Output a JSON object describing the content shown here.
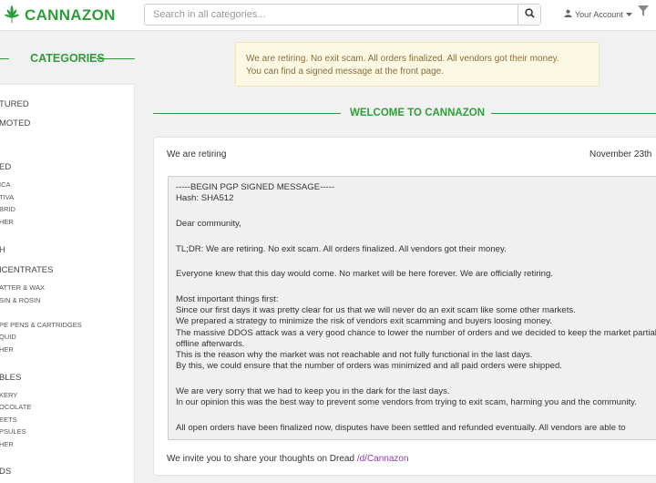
{
  "header": {
    "logo_text": "CANNAZON",
    "search_placeholder": "Search in all categories...",
    "account_label": "Your Account",
    "brand_color": "#2e9e3a"
  },
  "sidebar": {
    "title": "CATEGORIES",
    "items": [
      {
        "label": "TURED",
        "level": "main"
      },
      {
        "label": "MOTED",
        "level": "main"
      },
      {
        "label": "ED",
        "level": "main"
      },
      {
        "label": "ICA",
        "level": "sub"
      },
      {
        "label": "TIVA",
        "level": "sub"
      },
      {
        "label": "BRID",
        "level": "sub"
      },
      {
        "label": "HER",
        "level": "sub"
      },
      {
        "label": "H",
        "level": "main"
      },
      {
        "label": "ICENTRATES",
        "level": "main"
      },
      {
        "label": "ATTER & WAX",
        "level": "sub"
      },
      {
        "label": "SIN & ROSIN",
        "level": "sub"
      },
      {
        "label": "PE PENS & CARTRIDGES",
        "level": "sub"
      },
      {
        "label": "QUID",
        "level": "sub"
      },
      {
        "label": "HER",
        "level": "sub"
      },
      {
        "label": "BLES",
        "level": "main"
      },
      {
        "label": "KERY",
        "level": "sub"
      },
      {
        "label": "OCOLATE",
        "level": "sub"
      },
      {
        "label": "EETS",
        "level": "sub"
      },
      {
        "label": "PSULES",
        "level": "sub"
      },
      {
        "label": "HER",
        "level": "sub"
      },
      {
        "label": "DS",
        "level": "main"
      }
    ]
  },
  "alert": {
    "line1": "We are retiring. No exit scam. All orders finalized. All vendors got their money.",
    "line2": "You can find a signed message at the front page."
  },
  "welcome_title": "WELCOME TO CANNAZON",
  "post": {
    "title": "We are retiring",
    "date": "November 23th",
    "body": [
      "-----BEGIN PGP SIGNED MESSAGE-----",
      "Hash: SHA512",
      "",
      "Dear community,",
      "",
      "TL;DR: We are retiring. No exit scam. All orders finalized. All vendors got their money.",
      "",
      "Everyone knew that this day would come. No market will be here forever. We are officially retiring.",
      "",
      "Most important things first:",
      "Since our first days it was pretty clear for us that we will never do an exit scam like some other markets.",
      "We prepared a strategy to minimize the risk of vendors exit scamming and buyers loosing money.",
      "The massive DDOS attack was a very good chance to lower the number of orders and we decided to keep the market partially",
      "offline afterwards.",
      "This is the reason why the market was not reachable and not fully functional in the last days.",
      "By this, we could ensure that the number of orders was minimized and all paid orders were shipped.",
      "",
      "We are very sorry that we had to keep you in the dark for the last days.",
      "In our opinion this was the best way to prevent some vendors from trying to exit scam, harming you and the community.",
      "",
      "All open orders have been finalized now, disputes have been settled and refunded eventually. All vendors are able to"
    ],
    "invite_text": "We invite you to share your thoughts on Dread ",
    "invite_link": "/d/Cannazon",
    "link_color": "#8b3fb0"
  }
}
